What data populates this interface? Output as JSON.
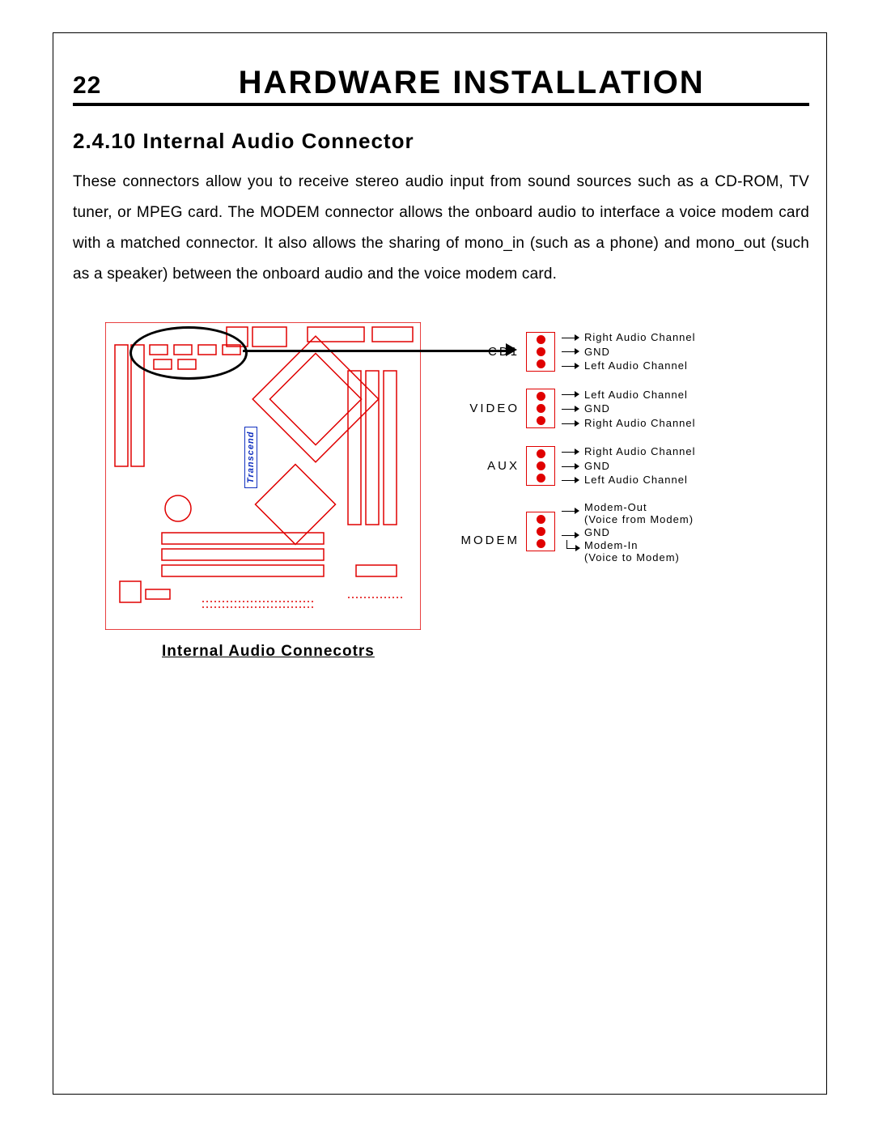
{
  "header": {
    "page_number": "22",
    "chapter_title": "HARDWARE INSTALLATION"
  },
  "section": {
    "number": "2.4.10",
    "title": "Internal Audio Connector"
  },
  "body_text": "These connectors allow you to receive stereo audio input from sound sources such as a CD-ROM, TV tuner, or MPEG card.  The MODEM connector allows the onboard audio to interface a voice modem card with a matched connector.  It also allows the sharing of mono_in (such as a phone) and mono_out (such as a speaker) between the onboard audio and the voice modem card.",
  "figure": {
    "brand": "Transcend",
    "caption": "Internal Audio Connecotrs",
    "connectors": [
      {
        "name": "CD1",
        "pins": [
          "Right Audio Channel",
          "GND",
          "Left Audio Channel"
        ]
      },
      {
        "name": "VIDEO",
        "pins": [
          "Left Audio Channel",
          "GND",
          "Right Audio Channel"
        ]
      },
      {
        "name": "AUX",
        "pins": [
          "Right Audio Channel",
          "GND",
          "Left Audio Channel"
        ]
      },
      {
        "name": "MODEM",
        "pins_multi": {
          "top": [
            "Modem-Out",
            "(Voice from Modem)"
          ],
          "mid": "GND",
          "bot": [
            "Modem-In",
            "(Voice to Modem)"
          ]
        }
      }
    ]
  }
}
